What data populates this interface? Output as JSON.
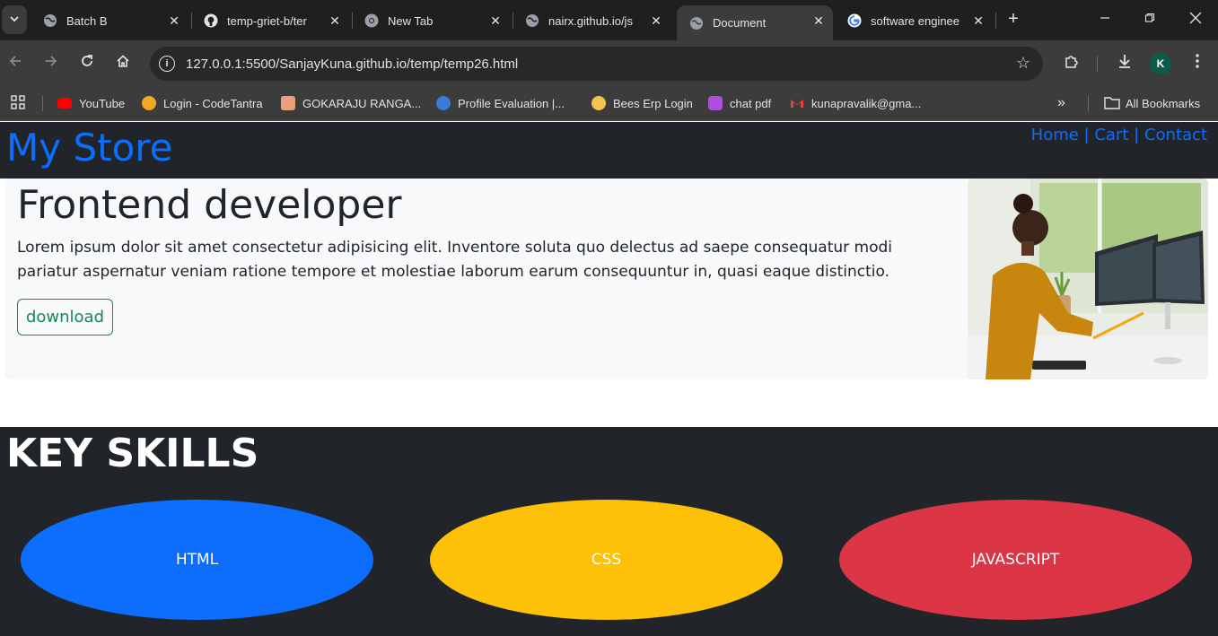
{
  "browser": {
    "tabs": [
      {
        "title": "Batch B",
        "icon": "globe-icon",
        "active": false
      },
      {
        "title": "temp-griet-b/ter",
        "icon": "github-icon",
        "active": false
      },
      {
        "title": "New Tab",
        "icon": "chrome-icon",
        "active": false
      },
      {
        "title": "nairx.github.io/js",
        "icon": "globe-icon",
        "active": false
      },
      {
        "title": "Document",
        "icon": "globe-icon",
        "active": true
      },
      {
        "title": "software enginee",
        "icon": "google-icon",
        "active": false
      }
    ],
    "url": "127.0.0.1:5500/SanjayKuna.github.io/temp/temp26.html",
    "profile_initial": "K",
    "bookmarks": [
      {
        "label": "YouTube",
        "icon": "youtube-icon",
        "color": "#ff0000"
      },
      {
        "label": "Login - CodeTantra",
        "icon": "codetantra-icon",
        "color": "#f5a623"
      },
      {
        "label": "GOKARAJU RANGA...",
        "icon": "griet-icon",
        "color": "#e8a07a"
      },
      {
        "label": "Profile Evaluation |...",
        "icon": "profile-eval-icon",
        "color": "#3a7bd5"
      },
      {
        "label": "Bees Erp Login",
        "icon": "bees-icon",
        "color": "#f3c34b"
      },
      {
        "label": "chat pdf",
        "icon": "chatpdf-icon",
        "color": "#b04ee0"
      },
      {
        "label": "kunapravalik@gma...",
        "icon": "gmail-icon",
        "color": "#ea4335"
      }
    ],
    "all_bookmarks_label": "All Bookmarks"
  },
  "site": {
    "brand": "My Store",
    "nav": {
      "home": "Home",
      "cart": "Cart",
      "contact": "Contact",
      "separator": "|"
    },
    "hero": {
      "title": "Frontend developer",
      "text": "Lorem ipsum dolor sit amet consectetur adipisicing elit. Inventore soluta quo delectus ad saepe consequatur modi pariatur aspernatur veniam ratione tempore et molestiae laborum earum consequuntur in, quasi eaque distinctio.",
      "button": "download"
    },
    "skills": {
      "heading": "KEY SKILLS",
      "items": [
        {
          "label": "HTML",
          "color": "#0d6efd"
        },
        {
          "label": "CSS",
          "color": "#ffc107"
        },
        {
          "label": "JAVASCRIPT",
          "color": "#dc3545"
        }
      ]
    }
  },
  "colors": {
    "brand_blue": "#0d6efd",
    "navbar_dark": "#212529",
    "success_green": "#198754"
  }
}
